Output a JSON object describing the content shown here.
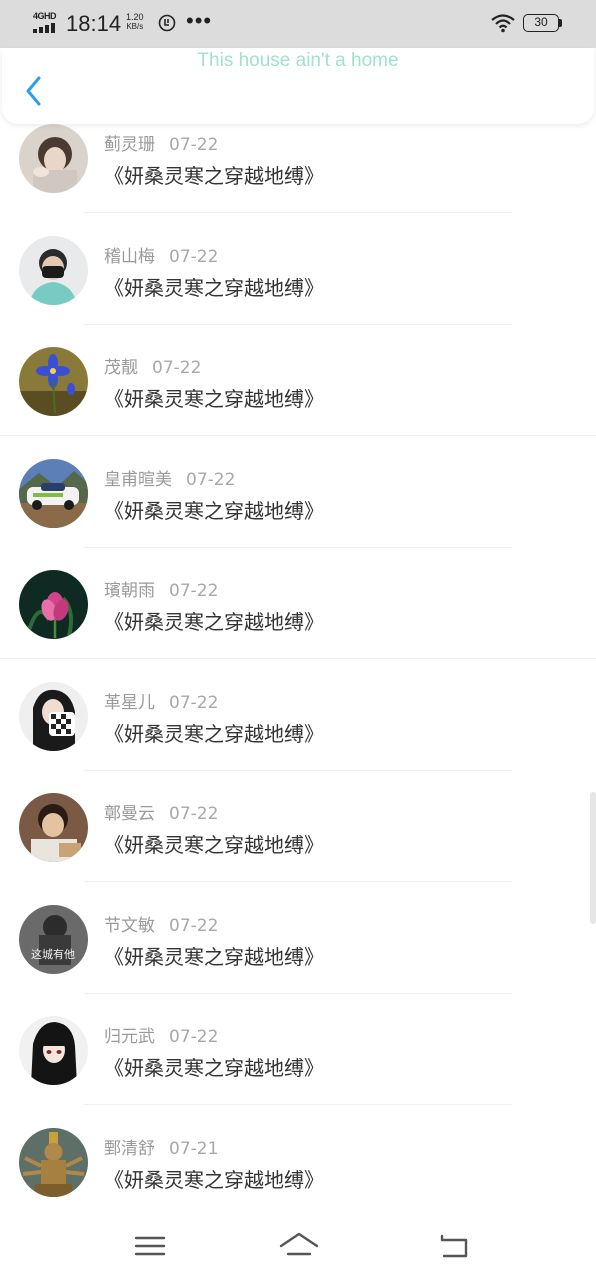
{
  "status_bar": {
    "network": "4GHD",
    "time": "18:14",
    "speed_value": "1.20",
    "speed_unit": "KB/s",
    "more_dots": "•••",
    "battery": "30"
  },
  "header": {
    "title": "This house ain't a home",
    "back_icon": "chevron-left-icon"
  },
  "colors": {
    "title": "#9fe3c8",
    "back": "#2a9df4"
  },
  "items": [
    {
      "name": "蓟灵珊",
      "date": "07-22",
      "title": "《妍桑灵寒之穿越地缚》"
    },
    {
      "name": "稽山梅",
      "date": "07-22",
      "title": "《妍桑灵寒之穿越地缚》"
    },
    {
      "name": "茂靓",
      "date": "07-22",
      "title": "《妍桑灵寒之穿越地缚》"
    },
    {
      "name": "皇甫暄美",
      "date": "07-22",
      "title": "《妍桑灵寒之穿越地缚》"
    },
    {
      "name": "璸朝雨",
      "date": "07-22",
      "title": "《妍桑灵寒之穿越地缚》"
    },
    {
      "name": "革星儿",
      "date": "07-22",
      "title": "《妍桑灵寒之穿越地缚》"
    },
    {
      "name": "鄣曼云",
      "date": "07-22",
      "title": "《妍桑灵寒之穿越地缚》"
    },
    {
      "name": "节文敏",
      "date": "07-22",
      "title": "《妍桑灵寒之穿越地缚》"
    },
    {
      "name": "归元武",
      "date": "07-22",
      "title": "《妍桑灵寒之穿越地缚》"
    },
    {
      "name": "鄄清舒",
      "date": "07-21",
      "title": "《妍桑灵寒之穿越地缚》"
    }
  ],
  "avatar_overlay_text": "这城有他",
  "nav": {
    "menu_icon": "menu-icon",
    "home_icon": "home-icon",
    "back_icon": "back-arrow-icon"
  }
}
